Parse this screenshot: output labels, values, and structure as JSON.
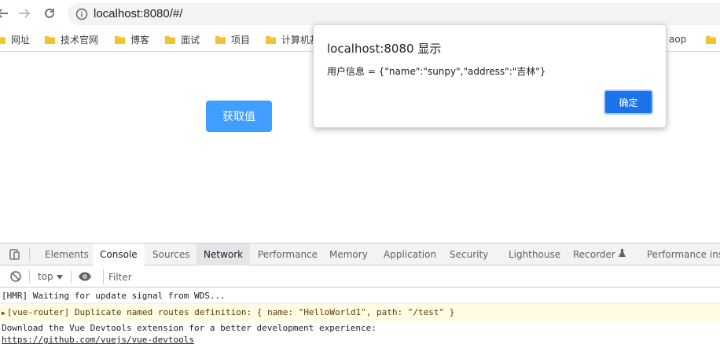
{
  "browser": {
    "url": "localhost:8080/#/",
    "bookmarks": [
      {
        "label": "网址"
      },
      {
        "label": "技术官网"
      },
      {
        "label": "博客"
      },
      {
        "label": "面试"
      },
      {
        "label": "项目"
      },
      {
        "label": "计算机基"
      },
      {
        "label": "aop"
      }
    ]
  },
  "page": {
    "button_label": "获取值",
    "button_color": "#409eff"
  },
  "dialog": {
    "title": "localhost:8080 显示",
    "message": "用户信息 = {\"name\":\"sunpy\",\"address\":\"吉林\"}",
    "ok_label": "确定",
    "ok_color": "#1a73e8"
  },
  "devtools": {
    "tabs": [
      {
        "label": "Elements"
      },
      {
        "label": "Console"
      },
      {
        "label": "Sources"
      },
      {
        "label": "Network"
      },
      {
        "label": "Performance"
      },
      {
        "label": "Memory"
      },
      {
        "label": "Application"
      },
      {
        "label": "Security"
      },
      {
        "label": "Lighthouse"
      },
      {
        "label": "Recorder"
      },
      {
        "label": "Performance insig"
      }
    ],
    "active_tab": "Console",
    "context": "top",
    "filter_placeholder": "Filter",
    "console": {
      "hmr": "[HMR] Waiting for update signal from WDS...",
      "warning": "[vue-router] Duplicate named routes definition: { name: \"HelloWorld1\", path: \"/test\" }",
      "devtools_msg": "Download the Vue Devtools extension for a better development experience:",
      "devtools_link": "https://github.com/vuejs/vue-devtools"
    },
    "warning_bg": "#fffbe5"
  }
}
